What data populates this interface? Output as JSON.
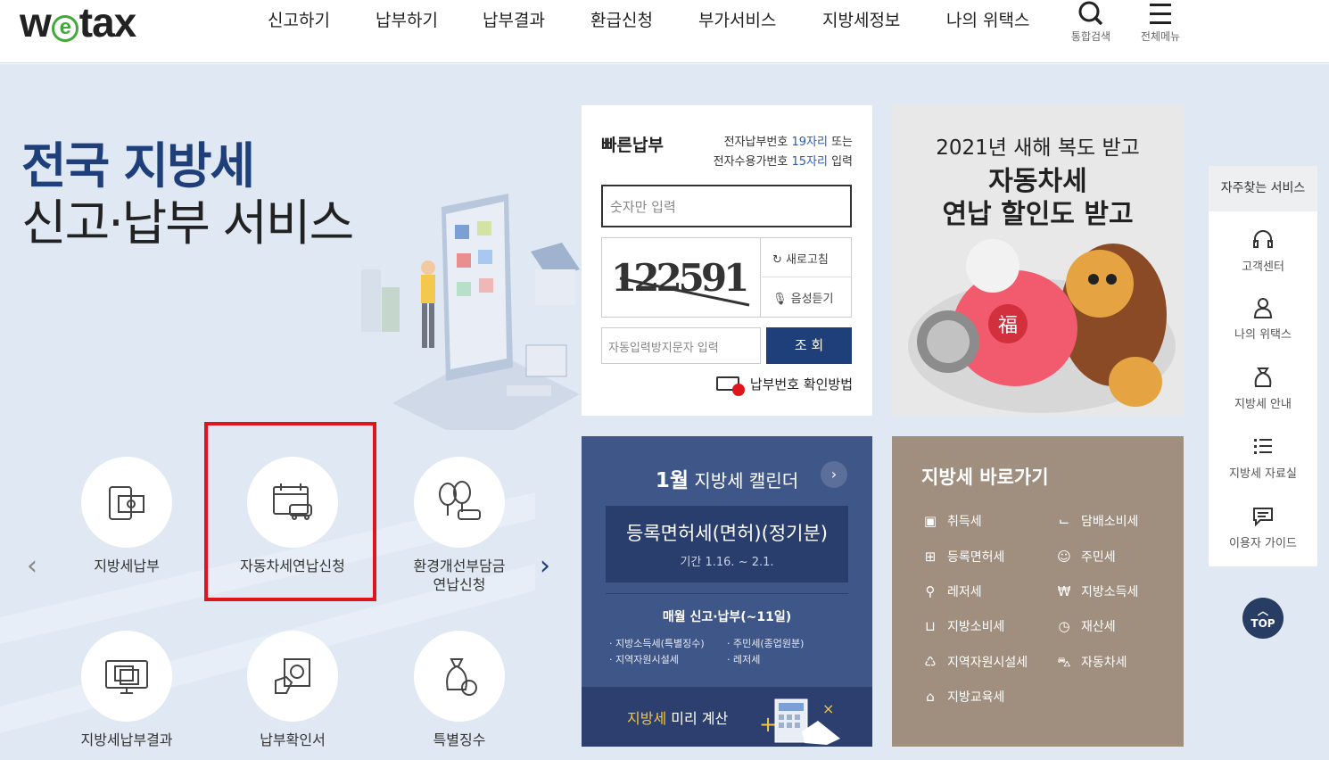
{
  "header": {
    "logo": "wetax",
    "logo_pre": "w",
    "logo_e": "e",
    "logo_post": "tax",
    "nav": [
      "신고하기",
      "납부하기",
      "납부결과",
      "환급신청",
      "부가서비스",
      "지방세정보",
      "나의 위택스"
    ],
    "search_label": "통합검색",
    "menu_label": "전체메뉴"
  },
  "hero": {
    "line1": "전국 지방세",
    "line2": "신고·납부 서비스"
  },
  "quickpay": {
    "title": "빠른납부",
    "desc_a": "전자납부번호 ",
    "desc_b": "19자리",
    "desc_c": " 또는",
    "desc_d": "전자수용가번호 ",
    "desc_e": "15자리",
    "desc_f": " 입력",
    "input_placeholder": "숫자만 입력",
    "captcha_text": "122591",
    "refresh_label": "새로고침",
    "audio_label": "음성듣기",
    "captcha_placeholder": "자동입력방지문자 입력",
    "submit_label": "조 회",
    "help_label": "납부번호 확인방법"
  },
  "promo": {
    "line1": "2021년 새해 복도 받고",
    "line2": "자동차세",
    "line3": "연납 할인도 받고",
    "badge": "福"
  },
  "calendar": {
    "month": "1월",
    "title": " 지방세 캘린더",
    "next": "›",
    "tax_name": "등록면허세(면허)(정기분)",
    "period": "기간 1.16. ~ 2.1.",
    "monthly": "매월 신고·납부(~11일)",
    "items": [
      "지방소득세(특별징수)",
      "주민세(종업원분)",
      "지역자원시설세",
      "레저세"
    ],
    "calc_a": "지방세",
    "calc_b": " 미리 계산"
  },
  "shortcut": {
    "title": "지방세 바로가기",
    "items": [
      "취득세",
      "담배소비세",
      "등록면허세",
      "주민세",
      "레저세",
      "지방소득세",
      "지방소비세",
      "재산세",
      "지역자원시설세",
      "자동차세",
      "지방교육세"
    ]
  },
  "services": [
    {
      "label": "지방세납부"
    },
    {
      "label": "자동차세연납신청"
    },
    {
      "label": "환경개선부담금\n연납신청"
    },
    {
      "label": "지방세납부결과"
    },
    {
      "label": "납부확인서"
    },
    {
      "label": "특별징수"
    }
  ],
  "carousel": {
    "prev": "‹",
    "next": "›"
  },
  "side": {
    "title": "자주찾는 서비스",
    "items": [
      "고객센터",
      "나의 위택스",
      "지방세 안내",
      "지방세 자료실",
      "이용자 가이드"
    ],
    "top": "TOP"
  },
  "colors": {
    "brand_navy": "#1e3f7a",
    "logo_green": "#43a83c",
    "calendar_bg": "#3f5688",
    "shortcut_bg": "#a08e7e",
    "highlight": "#e0151b",
    "main_bg": "#dfe8f3"
  }
}
